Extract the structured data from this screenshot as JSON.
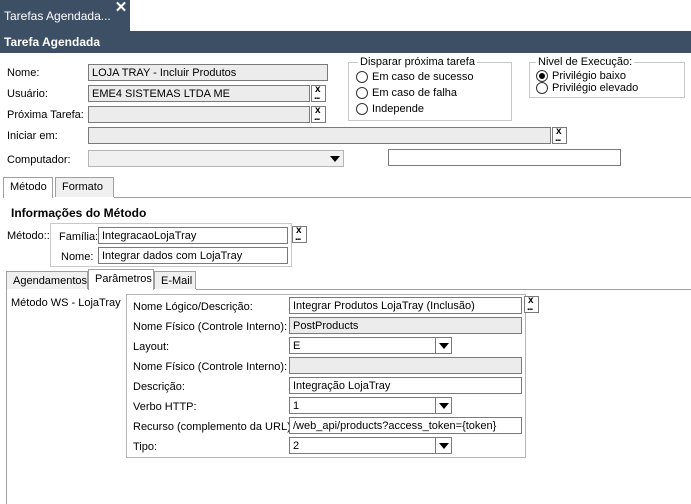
{
  "window": {
    "tab_title": "Tarefas Agendada...",
    "close_glyph": "✕",
    "header_title": "Tarefa Agendada"
  },
  "form": {
    "nome_label": "Nome:",
    "nome_value": "LOJA TRAY - Incluir Produtos",
    "usuario_label": "Usuário:",
    "usuario_value": "EME4 SISTEMAS LTDA ME",
    "proxima_label": "Próxima Tarefa:",
    "proxima_value": "",
    "iniciar_label": "Iniciar em:",
    "iniciar_value": "",
    "computador_label": "Computador:",
    "computador_value": "",
    "computador_extra": ""
  },
  "disparar": {
    "title": "Disparar próxima tarefa",
    "options": [
      "Em caso de sucesso",
      "Em caso de falha",
      "Independe"
    ]
  },
  "nivel": {
    "title": "Nivel de Execução:",
    "options": [
      "Privilégio baixo",
      "Privilégio elevado"
    ],
    "selected": "Privilégio baixo"
  },
  "main_tabs": [
    "Método",
    "Formato"
  ],
  "metodo": {
    "section_title": "Informações do Método",
    "metodo_label": "Método::",
    "familia_label": "Família:",
    "familia_value": "IntegracaoLojaTray",
    "nome_label": "Nome:",
    "nome_value": "Integrar dados com LojaTray"
  },
  "sub_tabs": [
    "Agendamentos",
    "Parâmetros",
    "E-Mail"
  ],
  "params": {
    "side_label": "Método WS - LojaTray",
    "rows": [
      {
        "label": "Nome Lógico/Descrição:",
        "value": "Integrar Produtos LojaTray (Inclusão)"
      },
      {
        "label": "Nome Físico (Controle Interno):",
        "value": "PostProducts"
      },
      {
        "label": "Layout:",
        "value": "E"
      },
      {
        "label": "Nome Físico (Controle Interno):",
        "value": ""
      },
      {
        "label": "Descrição:",
        "value": "Integração LojaTray"
      },
      {
        "label": "Verbo HTTP:",
        "value": "1"
      },
      {
        "label": "Recurso (complemento da URL):",
        "value": "/web_api/products?access_token={token}"
      },
      {
        "label": "Tipo:",
        "value": "2"
      }
    ]
  },
  "colors": {
    "header_bg": "#3c4f65",
    "field_border": "#7a7a7a",
    "readonly_bg": "#ececec"
  },
  "icons": {
    "lookup": "x-dots-lookup-icon",
    "dropdown": "chevron-down-icon",
    "close": "close-icon"
  }
}
